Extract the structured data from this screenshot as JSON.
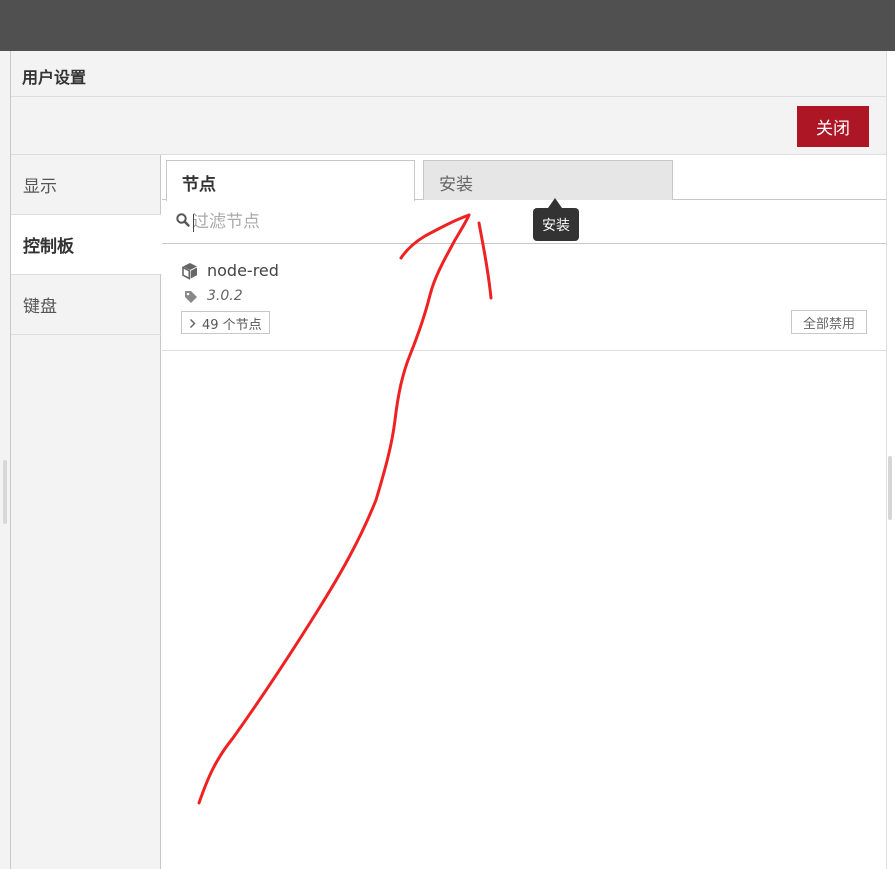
{
  "dialog": {
    "title": "用户设置",
    "close_label": "关闭"
  },
  "sidebar": {
    "items": [
      {
        "label": "显示",
        "active": false
      },
      {
        "label": "控制板",
        "active": true
      },
      {
        "label": "键盘",
        "active": false
      }
    ]
  },
  "tabs": [
    {
      "label": "节点",
      "active": true
    },
    {
      "label": "安装",
      "active": false
    }
  ],
  "tooltip": {
    "text": "安装"
  },
  "filter": {
    "placeholder": "过滤节点",
    "value": "",
    "icon": "search-icon"
  },
  "node": {
    "name": "node-red",
    "version": "3.0.2",
    "count_label": "49 个节点",
    "disable_all_label": "全部禁用",
    "icons": [
      "cube-icon",
      "tag-icon",
      "chevron-right-icon"
    ]
  },
  "colors": {
    "topbar": "#505050",
    "primary_button": "#ad1625",
    "annotation": "#ee2222"
  }
}
